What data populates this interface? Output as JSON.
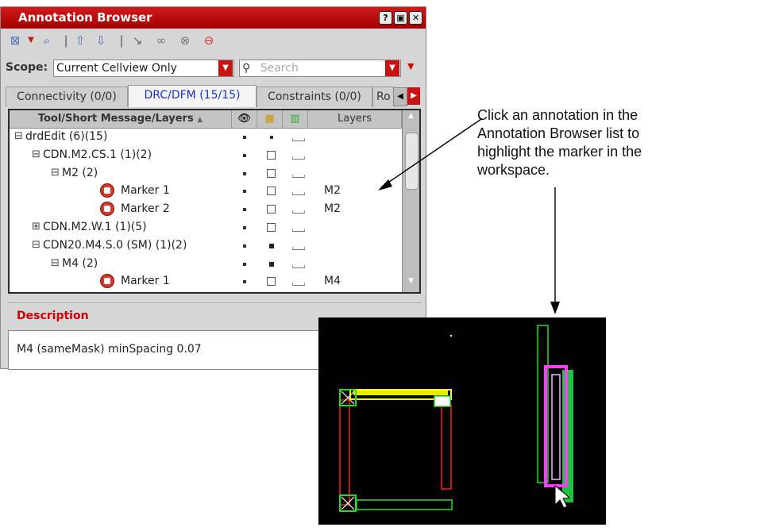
{
  "window": {
    "title": "Annotation Browser",
    "help_btn": "?",
    "restore_btn": "▣",
    "close_btn": "✕"
  },
  "toolbar": {
    "icons": [
      "select-icon",
      "zoom-icon",
      "up-arrow-icon",
      "down-arrow-icon",
      "pointer-icon",
      "link-icon",
      "unlink-icon",
      "delete-icon"
    ]
  },
  "scope": {
    "label": "Scope:",
    "value": "Current Cellview Only",
    "search_placeholder": "Search"
  },
  "tabs": [
    {
      "label": "Connectivity (0/0)"
    },
    {
      "label": "DRC/DFM (15/15)"
    },
    {
      "label": "Constraints (0/0)"
    },
    {
      "label": "Ro"
    }
  ],
  "tree": {
    "headers": {
      "name": "Tool/Short Message/Layers",
      "layers": "Layers"
    },
    "rows": [
      {
        "expander": "⊟",
        "label": "drdEdit (6)(15)",
        "layer": ""
      },
      {
        "expander": "⊟",
        "label": "CDN.M2.CS.1 (1)(2)",
        "layer": ""
      },
      {
        "expander": "⊟",
        "label": "M2 (2)",
        "layer": ""
      },
      {
        "expander": "",
        "label": "Marker 1",
        "layer": "M2"
      },
      {
        "expander": "",
        "label": "Marker 2",
        "layer": "M2"
      },
      {
        "expander": "⊞",
        "label": "CDN.M2.W.1 (1)(5)",
        "layer": ""
      },
      {
        "expander": "⊟",
        "label": "CDN20.M4.S.0 (SM) (1)(2)",
        "layer": ""
      },
      {
        "expander": "⊟",
        "label": "M4 (2)",
        "layer": ""
      },
      {
        "expander": "",
        "label": "Marker 1",
        "layer": "M4"
      }
    ]
  },
  "description": {
    "label": "Description",
    "text": "M4 (sameMask) minSpacing 0.07"
  },
  "callout": {
    "text": "Click an annotation in the Annotation Browser list to highlight the marker in the workspace."
  },
  "colors": {
    "title_red": "#c01010",
    "tab_active_text": "#1b32c8",
    "marker_magenta": "#ff3cff",
    "rect_red": "#ff2020",
    "rect_green": "#20e020",
    "rect_yellow": "#ffff00"
  }
}
